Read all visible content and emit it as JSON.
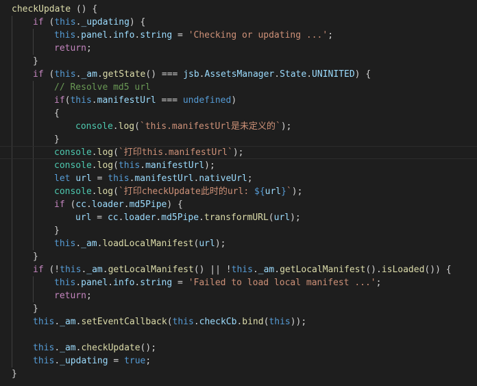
{
  "theme": {
    "background": "#1e1e1e",
    "default": "#d4d4d4",
    "function": "#dcdcaa",
    "control": "#c586c0",
    "keyword": "#569cd6",
    "property": "#9cdcfe",
    "string": "#ce9178",
    "comment": "#6a9955",
    "class": "#4ec9b0",
    "constant": "#4fc1ff",
    "indent_guide": "#404040"
  },
  "code": {
    "current_line": 11,
    "lines": [
      {
        "indent": 0,
        "tokens": [
          {
            "t": "checkUpdate",
            "c": "function"
          },
          {
            "t": " () {",
            "c": "default"
          }
        ]
      },
      {
        "indent": 1,
        "tokens": [
          {
            "t": "if",
            "c": "control"
          },
          {
            "t": " (",
            "c": "default"
          },
          {
            "t": "this",
            "c": "keyword"
          },
          {
            "t": ".",
            "c": "default"
          },
          {
            "t": "_updating",
            "c": "property"
          },
          {
            "t": ") {",
            "c": "default"
          }
        ]
      },
      {
        "indent": 2,
        "tokens": [
          {
            "t": "this",
            "c": "keyword"
          },
          {
            "t": ".",
            "c": "default"
          },
          {
            "t": "panel",
            "c": "property"
          },
          {
            "t": ".",
            "c": "default"
          },
          {
            "t": "info",
            "c": "property"
          },
          {
            "t": ".",
            "c": "default"
          },
          {
            "t": "string",
            "c": "property"
          },
          {
            "t": " = ",
            "c": "default"
          },
          {
            "t": "'Checking or updating ...'",
            "c": "string"
          },
          {
            "t": ";",
            "c": "default"
          }
        ]
      },
      {
        "indent": 2,
        "tokens": [
          {
            "t": "return",
            "c": "control"
          },
          {
            "t": ";",
            "c": "default"
          }
        ]
      },
      {
        "indent": 1,
        "tokens": [
          {
            "t": "}",
            "c": "default"
          }
        ]
      },
      {
        "indent": 1,
        "tokens": [
          {
            "t": "if",
            "c": "control"
          },
          {
            "t": " (",
            "c": "default"
          },
          {
            "t": "this",
            "c": "keyword"
          },
          {
            "t": ".",
            "c": "default"
          },
          {
            "t": "_am",
            "c": "property"
          },
          {
            "t": ".",
            "c": "default"
          },
          {
            "t": "getState",
            "c": "function"
          },
          {
            "t": "() === ",
            "c": "default"
          },
          {
            "t": "jsb",
            "c": "property"
          },
          {
            "t": ".",
            "c": "default"
          },
          {
            "t": "AssetsManager",
            "c": "property"
          },
          {
            "t": ".",
            "c": "default"
          },
          {
            "t": "State",
            "c": "property"
          },
          {
            "t": ".",
            "c": "default"
          },
          {
            "t": "UNINITED",
            "c": "property"
          },
          {
            "t": ") {",
            "c": "default"
          }
        ]
      },
      {
        "indent": 2,
        "tokens": [
          {
            "t": "// Resolve md5 url",
            "c": "comment"
          }
        ]
      },
      {
        "indent": 2,
        "tokens": [
          {
            "t": "if",
            "c": "control"
          },
          {
            "t": "(",
            "c": "default"
          },
          {
            "t": "this",
            "c": "keyword"
          },
          {
            "t": ".",
            "c": "default"
          },
          {
            "t": "manifestUrl",
            "c": "property"
          },
          {
            "t": " === ",
            "c": "default"
          },
          {
            "t": "undefined",
            "c": "keyword"
          },
          {
            "t": ")",
            "c": "default"
          }
        ]
      },
      {
        "indent": 2,
        "tokens": [
          {
            "t": "{",
            "c": "default"
          }
        ]
      },
      {
        "indent": 3,
        "tokens": [
          {
            "t": "console",
            "c": "class"
          },
          {
            "t": ".",
            "c": "default"
          },
          {
            "t": "log",
            "c": "function"
          },
          {
            "t": "(",
            "c": "default"
          },
          {
            "t": "`this.manifestUrl是未定义的`",
            "c": "string"
          },
          {
            "t": ");",
            "c": "default"
          }
        ]
      },
      {
        "indent": 2,
        "tokens": [
          {
            "t": "}",
            "c": "default"
          }
        ]
      },
      {
        "indent": 2,
        "tokens": [
          {
            "t": "console",
            "c": "class"
          },
          {
            "t": ".",
            "c": "default"
          },
          {
            "t": "log",
            "c": "function"
          },
          {
            "t": "(",
            "c": "default"
          },
          {
            "t": "`打印this.manifestUrl`",
            "c": "string"
          },
          {
            "t": ");",
            "c": "default"
          }
        ]
      },
      {
        "indent": 2,
        "tokens": [
          {
            "t": "console",
            "c": "class"
          },
          {
            "t": ".",
            "c": "default"
          },
          {
            "t": "log",
            "c": "function"
          },
          {
            "t": "(",
            "c": "default"
          },
          {
            "t": "this",
            "c": "keyword"
          },
          {
            "t": ".",
            "c": "default"
          },
          {
            "t": "manifestUrl",
            "c": "property"
          },
          {
            "t": ");",
            "c": "default"
          }
        ]
      },
      {
        "indent": 2,
        "tokens": [
          {
            "t": "let",
            "c": "keyword"
          },
          {
            "t": " ",
            "c": "default"
          },
          {
            "t": "url",
            "c": "property"
          },
          {
            "t": " = ",
            "c": "default"
          },
          {
            "t": "this",
            "c": "keyword"
          },
          {
            "t": ".",
            "c": "default"
          },
          {
            "t": "manifestUrl",
            "c": "property"
          },
          {
            "t": ".",
            "c": "default"
          },
          {
            "t": "nativeUrl",
            "c": "property"
          },
          {
            "t": ";",
            "c": "default"
          }
        ]
      },
      {
        "indent": 2,
        "tokens": [
          {
            "t": "console",
            "c": "class"
          },
          {
            "t": ".",
            "c": "default"
          },
          {
            "t": "log",
            "c": "function"
          },
          {
            "t": "(",
            "c": "default"
          },
          {
            "t": "`打印checkUpdate此时的url: ",
            "c": "string"
          },
          {
            "t": "${",
            "c": "keyword"
          },
          {
            "t": "url",
            "c": "property"
          },
          {
            "t": "}",
            "c": "keyword"
          },
          {
            "t": "`",
            "c": "string"
          },
          {
            "t": ");",
            "c": "default"
          }
        ]
      },
      {
        "indent": 2,
        "tokens": [
          {
            "t": "if",
            "c": "control"
          },
          {
            "t": " (",
            "c": "default"
          },
          {
            "t": "cc",
            "c": "property"
          },
          {
            "t": ".",
            "c": "default"
          },
          {
            "t": "loader",
            "c": "property"
          },
          {
            "t": ".",
            "c": "default"
          },
          {
            "t": "md5Pipe",
            "c": "property"
          },
          {
            "t": ") {",
            "c": "default"
          }
        ]
      },
      {
        "indent": 3,
        "tokens": [
          {
            "t": "url",
            "c": "property"
          },
          {
            "t": " = ",
            "c": "default"
          },
          {
            "t": "cc",
            "c": "property"
          },
          {
            "t": ".",
            "c": "default"
          },
          {
            "t": "loader",
            "c": "property"
          },
          {
            "t": ".",
            "c": "default"
          },
          {
            "t": "md5Pipe",
            "c": "property"
          },
          {
            "t": ".",
            "c": "default"
          },
          {
            "t": "transformURL",
            "c": "function"
          },
          {
            "t": "(",
            "c": "default"
          },
          {
            "t": "url",
            "c": "property"
          },
          {
            "t": ");",
            "c": "default"
          }
        ]
      },
      {
        "indent": 2,
        "tokens": [
          {
            "t": "}",
            "c": "default"
          }
        ]
      },
      {
        "indent": 2,
        "tokens": [
          {
            "t": "this",
            "c": "keyword"
          },
          {
            "t": ".",
            "c": "default"
          },
          {
            "t": "_am",
            "c": "property"
          },
          {
            "t": ".",
            "c": "default"
          },
          {
            "t": "loadLocalManifest",
            "c": "function"
          },
          {
            "t": "(",
            "c": "default"
          },
          {
            "t": "url",
            "c": "property"
          },
          {
            "t": ");",
            "c": "default"
          }
        ]
      },
      {
        "indent": 1,
        "tokens": [
          {
            "t": "}",
            "c": "default"
          }
        ]
      },
      {
        "indent": 1,
        "tokens": [
          {
            "t": "if",
            "c": "control"
          },
          {
            "t": " (!",
            "c": "default"
          },
          {
            "t": "this",
            "c": "keyword"
          },
          {
            "t": ".",
            "c": "default"
          },
          {
            "t": "_am",
            "c": "property"
          },
          {
            "t": ".",
            "c": "default"
          },
          {
            "t": "getLocalManifest",
            "c": "function"
          },
          {
            "t": "() || !",
            "c": "default"
          },
          {
            "t": "this",
            "c": "keyword"
          },
          {
            "t": ".",
            "c": "default"
          },
          {
            "t": "_am",
            "c": "property"
          },
          {
            "t": ".",
            "c": "default"
          },
          {
            "t": "getLocalManifest",
            "c": "function"
          },
          {
            "t": "().",
            "c": "default"
          },
          {
            "t": "isLoaded",
            "c": "function"
          },
          {
            "t": "()) {",
            "c": "default"
          }
        ]
      },
      {
        "indent": 2,
        "tokens": [
          {
            "t": "this",
            "c": "keyword"
          },
          {
            "t": ".",
            "c": "default"
          },
          {
            "t": "panel",
            "c": "property"
          },
          {
            "t": ".",
            "c": "default"
          },
          {
            "t": "info",
            "c": "property"
          },
          {
            "t": ".",
            "c": "default"
          },
          {
            "t": "string",
            "c": "property"
          },
          {
            "t": " = ",
            "c": "default"
          },
          {
            "t": "'Failed to load local manifest ...'",
            "c": "string"
          },
          {
            "t": ";",
            "c": "default"
          }
        ]
      },
      {
        "indent": 2,
        "tokens": [
          {
            "t": "return",
            "c": "control"
          },
          {
            "t": ";",
            "c": "default"
          }
        ]
      },
      {
        "indent": 1,
        "tokens": [
          {
            "t": "}",
            "c": "default"
          }
        ]
      },
      {
        "indent": 1,
        "tokens": [
          {
            "t": "this",
            "c": "keyword"
          },
          {
            "t": ".",
            "c": "default"
          },
          {
            "t": "_am",
            "c": "property"
          },
          {
            "t": ".",
            "c": "default"
          },
          {
            "t": "setEventCallback",
            "c": "function"
          },
          {
            "t": "(",
            "c": "default"
          },
          {
            "t": "this",
            "c": "keyword"
          },
          {
            "t": ".",
            "c": "default"
          },
          {
            "t": "checkCb",
            "c": "property"
          },
          {
            "t": ".",
            "c": "default"
          },
          {
            "t": "bind",
            "c": "function"
          },
          {
            "t": "(",
            "c": "default"
          },
          {
            "t": "this",
            "c": "keyword"
          },
          {
            "t": "));",
            "c": "default"
          }
        ]
      },
      {
        "indent": 0,
        "tokens": []
      },
      {
        "indent": 1,
        "tokens": [
          {
            "t": "this",
            "c": "keyword"
          },
          {
            "t": ".",
            "c": "default"
          },
          {
            "t": "_am",
            "c": "property"
          },
          {
            "t": ".",
            "c": "default"
          },
          {
            "t": "checkUpdate",
            "c": "function"
          },
          {
            "t": "();",
            "c": "default"
          }
        ]
      },
      {
        "indent": 1,
        "tokens": [
          {
            "t": "this",
            "c": "keyword"
          },
          {
            "t": ".",
            "c": "default"
          },
          {
            "t": "_updating",
            "c": "property"
          },
          {
            "t": " = ",
            "c": "default"
          },
          {
            "t": "true",
            "c": "keyword"
          },
          {
            "t": ";",
            "c": "default"
          }
        ]
      },
      {
        "indent": 0,
        "tokens": [
          {
            "t": "}",
            "c": "default"
          }
        ]
      }
    ]
  }
}
